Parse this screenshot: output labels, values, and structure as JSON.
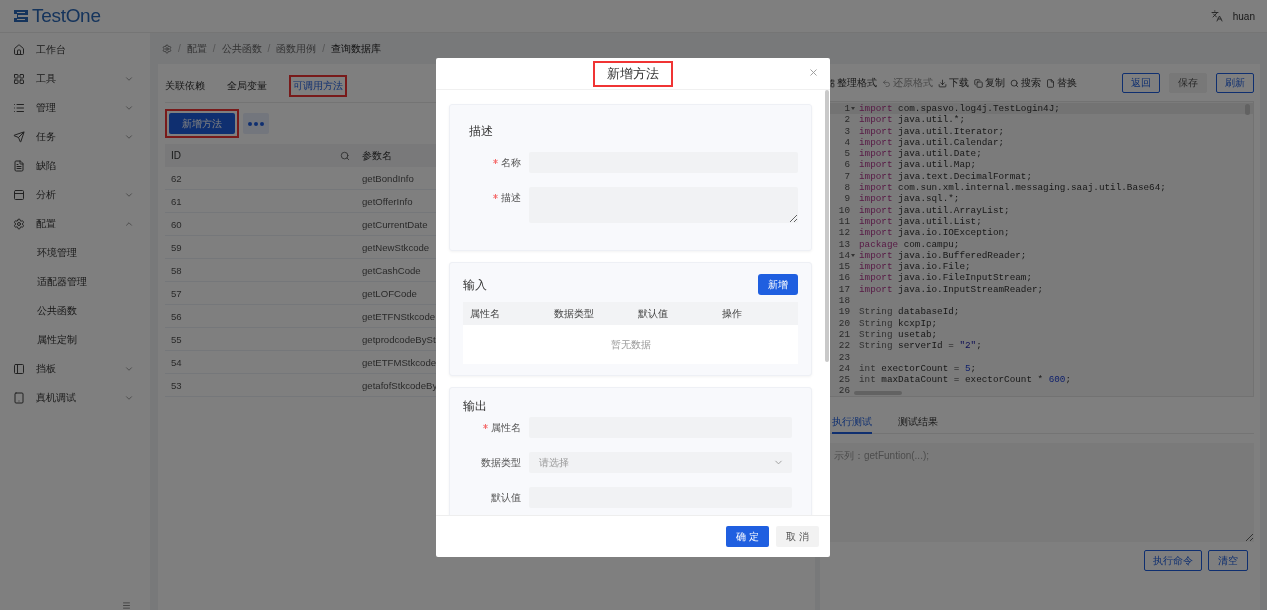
{
  "header": {
    "app_name": "TestOne",
    "user": "huan"
  },
  "sidebar": {
    "items": [
      {
        "label": "工作台",
        "kind": "link"
      },
      {
        "label": "工具",
        "kind": "group",
        "expanded": false
      },
      {
        "label": "管理",
        "kind": "group",
        "expanded": false
      },
      {
        "label": "任务",
        "kind": "group",
        "expanded": false
      },
      {
        "label": "缺陷",
        "kind": "link"
      },
      {
        "label": "分析",
        "kind": "group",
        "expanded": false
      },
      {
        "label": "配置",
        "kind": "group",
        "expanded": true,
        "children": [
          {
            "label": "环境管理"
          },
          {
            "label": "适配器管理"
          },
          {
            "label": "公共函数"
          },
          {
            "label": "属性定制"
          }
        ]
      },
      {
        "label": "挡板",
        "kind": "group",
        "expanded": false
      },
      {
        "label": "真机调试",
        "kind": "group",
        "expanded": false
      }
    ]
  },
  "breadcrumb": {
    "separator": "/",
    "items": [
      "配置",
      "公共函数",
      "函数用例",
      "查询数据库"
    ]
  },
  "left_panel": {
    "tabs": [
      {
        "label": "关联依赖",
        "selected": false,
        "highlighted": false
      },
      {
        "label": "全局变量",
        "selected": false,
        "highlighted": false
      },
      {
        "label": "可调用方法",
        "selected": true,
        "highlighted": true
      }
    ],
    "new_method_button": {
      "label": "新增方法",
      "highlighted": true
    },
    "table": {
      "columns": [
        "ID",
        "参数名"
      ],
      "rows": [
        {
          "id": "62",
          "name": "getBondInfo"
        },
        {
          "id": "61",
          "name": "getOfferInfo"
        },
        {
          "id": "60",
          "name": "getCurrentDate"
        },
        {
          "id": "59",
          "name": "getNewStkcode"
        },
        {
          "id": "58",
          "name": "getCashCode"
        },
        {
          "id": "57",
          "name": "getLOFCode"
        },
        {
          "id": "56",
          "name": "getETFNStkcode"
        },
        {
          "id": "55",
          "name": "getprodcodeBySt"
        },
        {
          "id": "54",
          "name": "getETFMStkcode"
        },
        {
          "id": "53",
          "name": "getafofStkcodeBy"
        }
      ]
    }
  },
  "editor": {
    "tools": [
      {
        "label": "整理格式",
        "disabled": false
      },
      {
        "label": "还原格式",
        "disabled": true
      },
      {
        "label": "下载",
        "disabled": false
      },
      {
        "label": "复制",
        "disabled": false
      },
      {
        "label": "搜索",
        "disabled": false
      },
      {
        "label": "替换",
        "disabled": false
      }
    ],
    "buttons": [
      {
        "label": "返回",
        "kind": "outline"
      },
      {
        "label": "保存",
        "kind": "plain"
      },
      {
        "label": "刷新",
        "kind": "outline"
      }
    ],
    "lines": [
      {
        "number": "1",
        "fold": true,
        "active": true,
        "tokens": [
          {
            "kind": "keyword",
            "text": "import"
          },
          {
            "kind": "plain",
            "text": " com.spasvo.log4j.TestLogin4J;"
          }
        ]
      },
      {
        "number": "2",
        "fold": false,
        "active": false,
        "tokens": [
          {
            "kind": "keyword",
            "text": "import"
          },
          {
            "kind": "plain",
            "text": " java.util.*;"
          }
        ]
      },
      {
        "number": "3",
        "fold": false,
        "active": false,
        "tokens": [
          {
            "kind": "keyword",
            "text": "import"
          },
          {
            "kind": "plain",
            "text": " java.util.Iterator;"
          }
        ]
      },
      {
        "number": "4",
        "fold": false,
        "active": false,
        "tokens": [
          {
            "kind": "keyword",
            "text": "import"
          },
          {
            "kind": "plain",
            "text": " java.util.Calendar;"
          }
        ]
      },
      {
        "number": "5",
        "fold": false,
        "active": false,
        "tokens": [
          {
            "kind": "keyword",
            "text": "import"
          },
          {
            "kind": "plain",
            "text": " java.util.Date;"
          }
        ]
      },
      {
        "number": "6",
        "fold": false,
        "active": false,
        "tokens": [
          {
            "kind": "keyword",
            "text": "import"
          },
          {
            "kind": "plain",
            "text": " java.util.Map;"
          }
        ]
      },
      {
        "number": "7",
        "fold": false,
        "active": false,
        "tokens": [
          {
            "kind": "keyword",
            "text": "import"
          },
          {
            "kind": "plain",
            "text": " java.text.DecimalFormat;"
          }
        ]
      },
      {
        "number": "8",
        "fold": false,
        "active": false,
        "tokens": [
          {
            "kind": "keyword",
            "text": "import"
          },
          {
            "kind": "plain",
            "text": " com.sun.xml.internal.messaging.saaj.util.Base64;"
          }
        ]
      },
      {
        "number": "9",
        "fold": false,
        "active": false,
        "tokens": [
          {
            "kind": "keyword",
            "text": "import"
          },
          {
            "kind": "plain",
            "text": " java.sql.*;"
          }
        ]
      },
      {
        "number": "10",
        "fold": false,
        "active": false,
        "tokens": [
          {
            "kind": "keyword",
            "text": "import"
          },
          {
            "kind": "plain",
            "text": " java.util.ArrayList;"
          }
        ]
      },
      {
        "number": "11",
        "fold": false,
        "active": false,
        "tokens": [
          {
            "kind": "keyword",
            "text": "import"
          },
          {
            "kind": "plain",
            "text": " java.util.List;"
          }
        ]
      },
      {
        "number": "12",
        "fold": false,
        "active": false,
        "tokens": [
          {
            "kind": "keyword",
            "text": "import"
          },
          {
            "kind": "plain",
            "text": " java.io.IOException;"
          }
        ]
      },
      {
        "number": "13",
        "fold": false,
        "active": false,
        "tokens": [
          {
            "kind": "keyword",
            "text": "package"
          },
          {
            "kind": "plain",
            "text": " com.campu;"
          }
        ]
      },
      {
        "number": "14",
        "fold": true,
        "active": false,
        "tokens": [
          {
            "kind": "keyword",
            "text": "import"
          },
          {
            "kind": "plain",
            "text": " java.io.BufferedReader;"
          }
        ]
      },
      {
        "number": "15",
        "fold": false,
        "active": false,
        "tokens": [
          {
            "kind": "keyword",
            "text": "import"
          },
          {
            "kind": "plain",
            "text": " java.io.File;"
          }
        ]
      },
      {
        "number": "16",
        "fold": false,
        "active": false,
        "tokens": [
          {
            "kind": "keyword",
            "text": "import"
          },
          {
            "kind": "plain",
            "text": " java.io.FileInputStream;"
          }
        ]
      },
      {
        "number": "17",
        "fold": false,
        "active": false,
        "tokens": [
          {
            "kind": "keyword",
            "text": "import"
          },
          {
            "kind": "plain",
            "text": " java.io.InputStreamReader;"
          }
        ]
      },
      {
        "number": "18",
        "fold": false,
        "active": false
      },
      {
        "number": "19",
        "fold": false,
        "active": false,
        "tokens": [
          {
            "kind": "type",
            "text": "String"
          },
          {
            "kind": "plain",
            "text": " databaseId;"
          }
        ]
      },
      {
        "number": "20",
        "fold": false,
        "active": false,
        "tokens": [
          {
            "kind": "type",
            "text": "String"
          },
          {
            "kind": "plain",
            "text": " kcxpIp;"
          }
        ]
      },
      {
        "number": "21",
        "fold": false,
        "active": false,
        "tokens": [
          {
            "kind": "type",
            "text": "String"
          },
          {
            "kind": "plain",
            "text": " usetab;"
          }
        ]
      },
      {
        "number": "22",
        "fold": false,
        "active": false,
        "tokens": [
          {
            "kind": "type",
            "text": "String"
          },
          {
            "kind": "plain",
            "text": " serverId = "
          },
          {
            "kind": "string",
            "text": "\"2\""
          },
          {
            "kind": "plain",
            "text": ";"
          }
        ]
      },
      {
        "number": "23",
        "fold": false,
        "active": false
      },
      {
        "number": "24",
        "fold": false,
        "active": false,
        "tokens": [
          {
            "kind": "type",
            "text": "int"
          },
          {
            "kind": "plain",
            "text": " exectorCount = "
          },
          {
            "kind": "number",
            "text": "5"
          },
          {
            "kind": "plain",
            "text": ";"
          }
        ]
      },
      {
        "number": "25",
        "fold": false,
        "active": false,
        "tokens": [
          {
            "kind": "type",
            "text": "int"
          },
          {
            "kind": "plain",
            "text": " maxDataCount = exectorCount * "
          },
          {
            "kind": "number",
            "text": "600"
          },
          {
            "kind": "plain",
            "text": ";"
          }
        ]
      },
      {
        "number": "26",
        "fold": false,
        "active": false
      }
    ],
    "bottom_tabs": [
      {
        "label": "执行测试",
        "selected": true
      },
      {
        "label": "测试结果",
        "selected": false
      }
    ],
    "command": {
      "placeholder": "示列：getFuntion(...);"
    },
    "command_buttons": [
      "执行命令",
      "清空"
    ]
  },
  "modal": {
    "title": {
      "text": "新增方法",
      "highlighted": true
    },
    "description_section": {
      "heading": "描述",
      "fields": [
        {
          "label": "名称",
          "kind": "input",
          "required": true
        },
        {
          "label": "描述",
          "kind": "textarea",
          "required": true
        }
      ]
    },
    "input_section": {
      "heading": "输入",
      "add_button": "新增",
      "columns": [
        "属性名",
        "数据类型",
        "默认值",
        "操作"
      ],
      "empty_text": "暂无数据"
    },
    "output_section": {
      "heading": "输出",
      "fields": [
        {
          "label": "属性名",
          "kind": "input",
          "required": true
        },
        {
          "label": "数据类型",
          "kind": "select",
          "required": false,
          "placeholder": "请选择"
        },
        {
          "label": "默认值",
          "kind": "input",
          "required": false
        }
      ]
    },
    "buttons": [
      {
        "label": "确 定",
        "kind": "primary"
      },
      {
        "label": "取 消",
        "kind": "plain"
      }
    ]
  }
}
